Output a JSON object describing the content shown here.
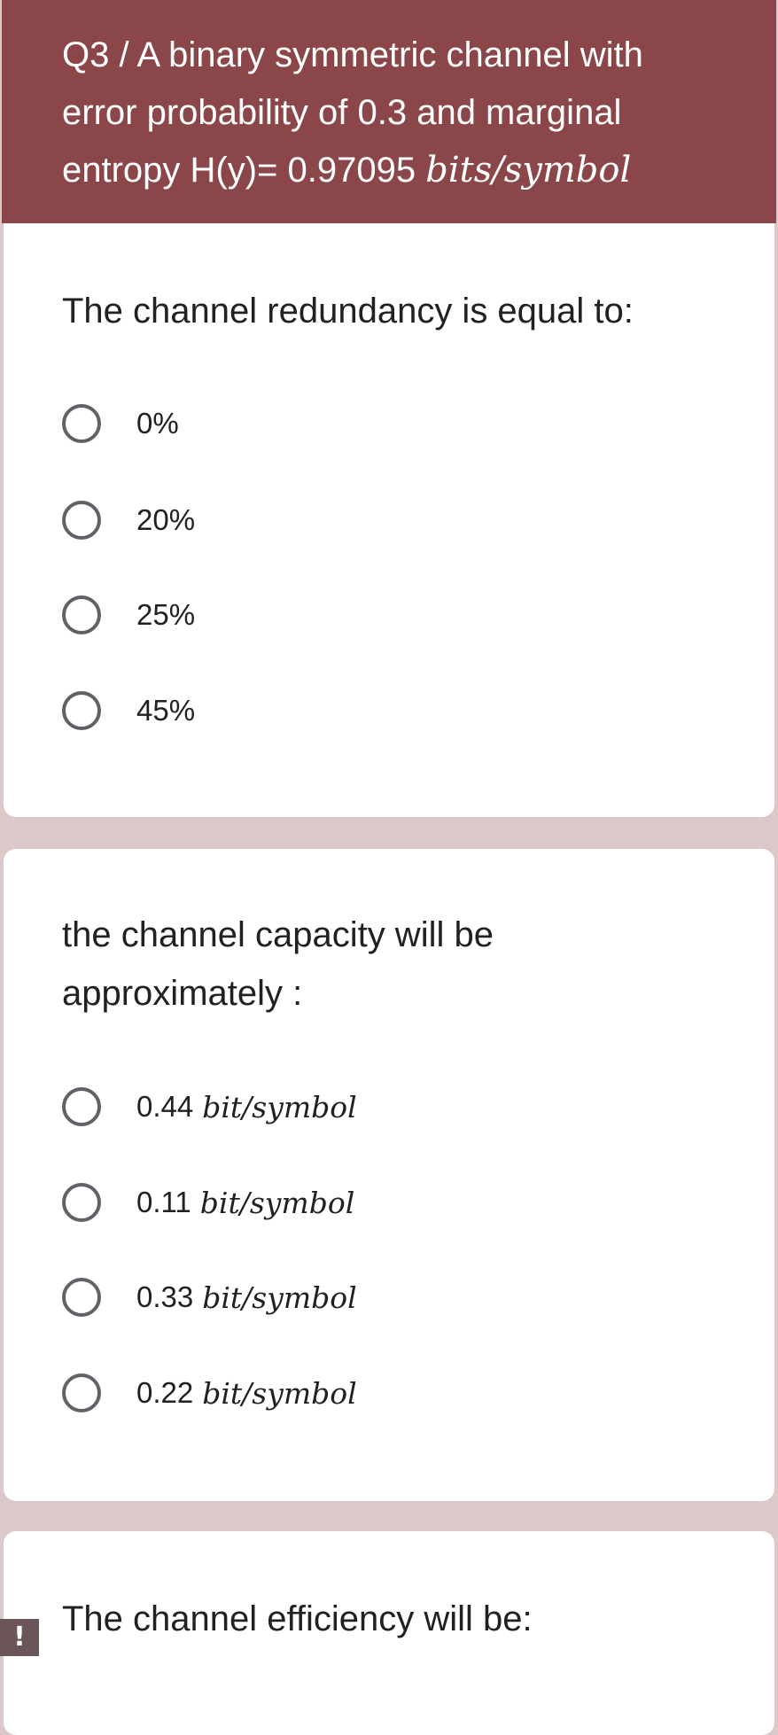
{
  "section": {
    "title_text": "Q3 / A binary symmetric channel with error probability of 0.3 and marginal entropy H(y)= 0.97095",
    "title_unit": "bits/symbol"
  },
  "questions": [
    {
      "prompt": "The channel redundancy is equal to:",
      "options": [
        {
          "value": "0%",
          "unit": ""
        },
        {
          "value": "20%",
          "unit": ""
        },
        {
          "value": "25%",
          "unit": ""
        },
        {
          "value": "45%",
          "unit": ""
        }
      ]
    },
    {
      "prompt": "the channel capacity will be approximately :",
      "options": [
        {
          "value": "0.44",
          "unit": "bit/symbol"
        },
        {
          "value": "0.11",
          "unit": "bit/symbol"
        },
        {
          "value": "0.33",
          "unit": "bit/symbol"
        },
        {
          "value": "0.22",
          "unit": "bit/symbol"
        }
      ]
    },
    {
      "prompt": "The channel efficiency will be:",
      "options": []
    }
  ],
  "alert_badge": "!",
  "colors": {
    "header_bg": "#8a4648",
    "page_bg": "#dcc8c9",
    "card_bg": "#ffffff",
    "radio_border": "#5f6368"
  },
  "icons": {
    "radio": "radio-unchecked-icon",
    "alert": "exclamation-icon"
  }
}
